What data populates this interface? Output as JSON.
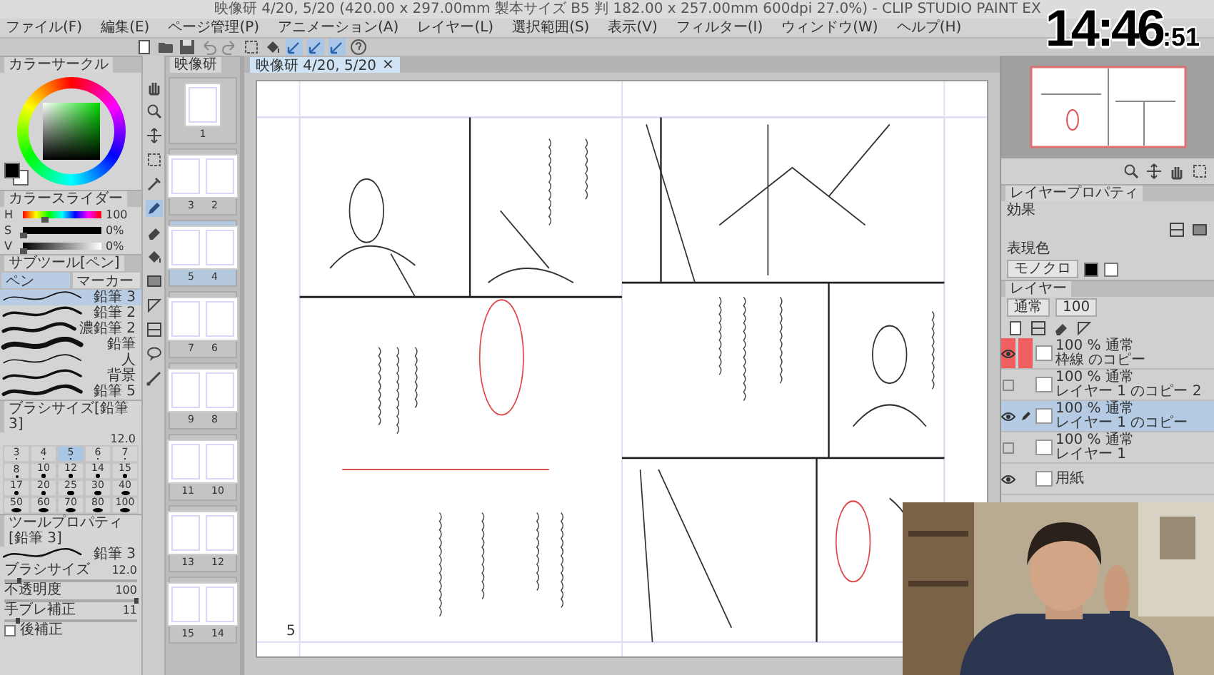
{
  "window": {
    "title": "映像研 4/20, 5/20 (420.00 x 297.00mm 製本サイズ B5 判 182.00 x 257.00mm 600dpi 27.0%) - CLIP STUDIO PAINT EX"
  },
  "menu": [
    "ファイル(F)",
    "編集(E)",
    "ページ管理(P)",
    "アニメーション(A)",
    "レイヤー(L)",
    "選択範囲(S)",
    "表示(V)",
    "フィルター(I)",
    "ウィンドウ(W)",
    "ヘルプ(H)"
  ],
  "toolbar": [
    {
      "kind": "new",
      "selected": false
    },
    {
      "kind": "open",
      "selected": false
    },
    {
      "kind": "save",
      "selected": false
    },
    {
      "kind": "undo",
      "selected": false
    },
    {
      "kind": "redo",
      "selected": false
    },
    {
      "kind": "select",
      "selected": false
    },
    {
      "kind": "fill",
      "selected": false
    },
    {
      "kind": "snap",
      "selected": true
    },
    {
      "kind": "snap",
      "selected": true
    },
    {
      "kind": "snap",
      "selected": true
    },
    {
      "kind": "help",
      "selected": false
    }
  ],
  "color_wheel": {
    "tab": "カラーサークル"
  },
  "color_slider": {
    "tab": "カラースライダー",
    "rows": [
      {
        "kind": "hue",
        "label": "H",
        "value": "100",
        "level": 0.28
      },
      {
        "kind": "saturation",
        "label": "S",
        "value": "0%",
        "level": 0
      },
      {
        "kind": "brightness",
        "label": "V",
        "value": "0%",
        "level": 0
      }
    ]
  },
  "sub_tool": {
    "tab": "サブツール[ペン]",
    "groups": [
      {
        "label": "ペン",
        "selected": true
      },
      {
        "label": "マーカー",
        "selected": false
      }
    ],
    "brushes": [
      {
        "name": "鉛筆 3",
        "selected": true
      },
      {
        "name": "鉛筆 2",
        "selected": false
      },
      {
        "name": "濃鉛筆 2",
        "selected": false
      },
      {
        "name": "鉛筆",
        "selected": false
      },
      {
        "name": "人",
        "selected": false
      },
      {
        "name": "背景",
        "selected": false
      },
      {
        "name": "鉛筆 5",
        "selected": false
      }
    ]
  },
  "brush_size": {
    "tab": "ブラシサイズ[鉛筆 3]",
    "value": "12.0",
    "sizes": [
      {
        "label": "3",
        "selected": false
      },
      {
        "label": "4",
        "selected": false
      },
      {
        "label": "5",
        "selected": true
      },
      {
        "label": "6",
        "selected": false
      },
      {
        "label": "7",
        "selected": false
      },
      {
        "label": "8",
        "selected": false
      },
      {
        "label": "10",
        "selected": false
      },
      {
        "label": "12",
        "selected": false
      },
      {
        "label": "14",
        "selected": false
      },
      {
        "label": "15",
        "selected": false
      },
      {
        "label": "17",
        "selected": false
      },
      {
        "label": "20",
        "selected": false
      },
      {
        "label": "25",
        "selected": false
      },
      {
        "label": "30",
        "selected": false
      },
      {
        "label": "40",
        "selected": false
      },
      {
        "label": "50",
        "selected": false
      },
      {
        "label": "60",
        "selected": false
      },
      {
        "label": "70",
        "selected": false
      },
      {
        "label": "80",
        "selected": false
      },
      {
        "label": "100",
        "selected": false
      }
    ]
  },
  "tool_property": {
    "tab": "ツールプロパティ[鉛筆 3]",
    "brush": "鉛筆 3",
    "rows": [
      {
        "label": "ブラシサイズ",
        "value": "12.0",
        "level": 0.12
      },
      {
        "label": "不透明度",
        "value": "100",
        "level": 1
      },
      {
        "label": "手ブレ補正",
        "value": "11",
        "level": 0.11
      }
    ],
    "options": [
      {
        "label": "後補正",
        "checked": false
      }
    ]
  },
  "tools": [
    {
      "kind": "hand",
      "selected": false
    },
    {
      "kind": "zoom",
      "selected": false
    },
    {
      "kind": "move",
      "selected": false
    },
    {
      "kind": "select",
      "selected": false
    },
    {
      "kind": "eyedropper",
      "selected": false
    },
    {
      "kind": "pen",
      "selected": true
    },
    {
      "kind": "eraser",
      "selected": false
    },
    {
      "kind": "fill",
      "selected": false
    },
    {
      "kind": "gradient",
      "selected": false
    },
    {
      "kind": "shape",
      "selected": false
    },
    {
      "kind": "frame",
      "selected": false
    },
    {
      "kind": "balloon",
      "selected": false
    },
    {
      "kind": "ruler",
      "selected": false
    }
  ],
  "page_manager": {
    "tab": "映像研",
    "pages": [
      {
        "labels": [
          "1"
        ],
        "selected": false
      },
      {
        "labels": [
          "3",
          "2"
        ],
        "selected": false
      },
      {
        "labels": [
          "5",
          "4"
        ],
        "selected": true
      },
      {
        "labels": [
          "7",
          "6"
        ],
        "selected": false
      },
      {
        "labels": [
          "9",
          "8"
        ],
        "selected": false
      },
      {
        "labels": [
          "11",
          "10"
        ],
        "selected": false
      },
      {
        "labels": [
          "13",
          "12"
        ],
        "selected": false
      },
      {
        "labels": [
          "15",
          "14"
        ],
        "selected": false
      }
    ]
  },
  "document": {
    "tab": "映像研 4/20, 5/20",
    "close": "×",
    "page_number": "5"
  },
  "layer_property": {
    "tab": "レイヤープロパティ",
    "effect_label": "効果",
    "color_label": "表現色",
    "color_mode": "モノクロ"
  },
  "layers": {
    "tab": "レイヤー",
    "blend": "通常",
    "opacity": "100",
    "items": [
      {
        "info": "100 % 通常",
        "name": "枠線 のコピー",
        "visible": true,
        "marked": true,
        "selected": false
      },
      {
        "info": "100 % 通常",
        "name": "レイヤー 1 のコピー 2",
        "visible": false,
        "marked": false,
        "selected": false
      },
      {
        "info": "100 % 通常",
        "name": "レイヤー 1 のコピー",
        "visible": true,
        "marked": false,
        "selected": true
      },
      {
        "info": "100 % 通常",
        "name": "レイヤー 1",
        "visible": false,
        "marked": false,
        "selected": false
      },
      {
        "name": "用紙",
        "visible": true,
        "marked": false,
        "selected": false
      }
    ]
  },
  "clock": {
    "time": "14:46",
    "seconds": ":51"
  },
  "webcam": {
    "kind": "picture"
  }
}
